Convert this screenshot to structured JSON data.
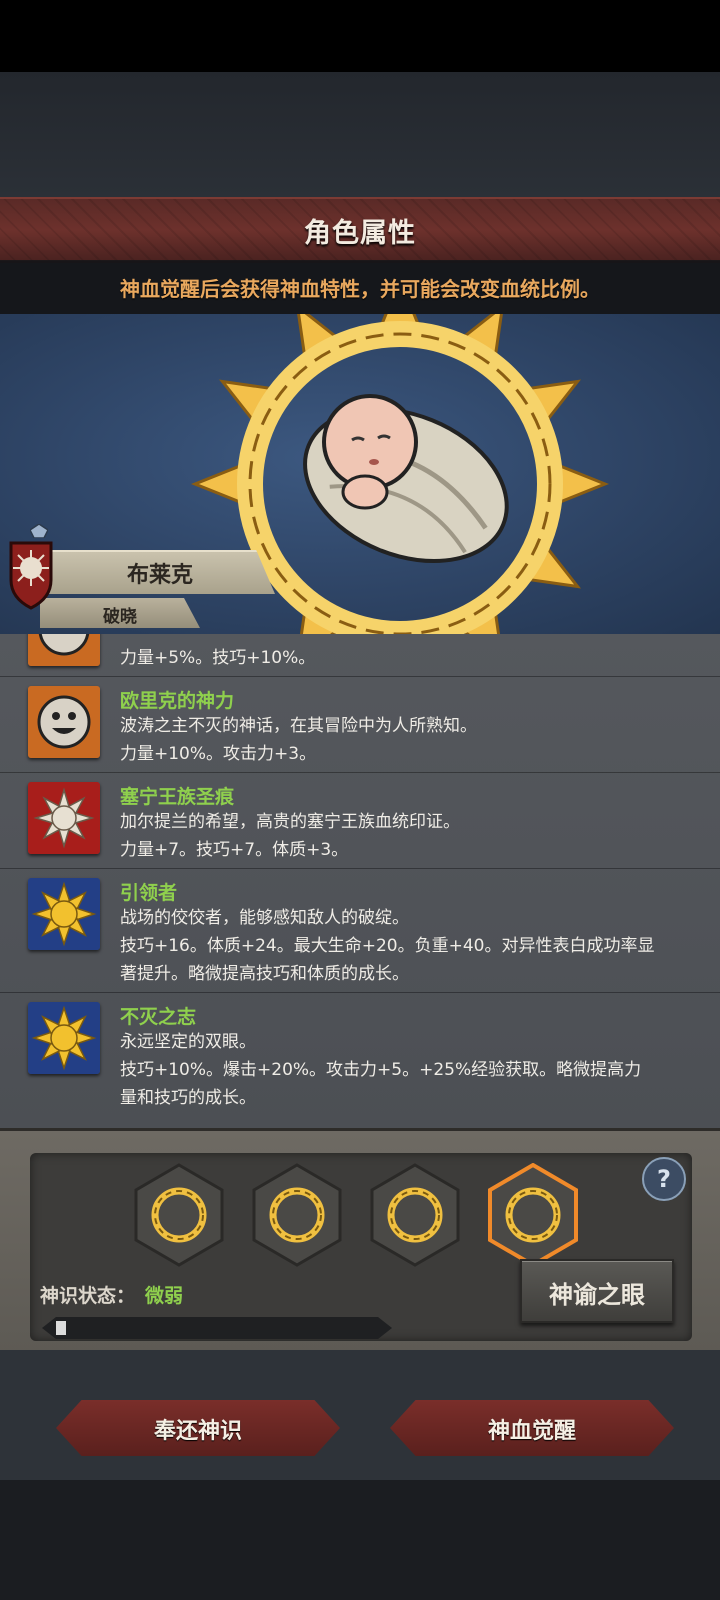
{
  "header": {
    "title": "角色属性",
    "notice": "神血觉醒后会获得神血特性，并可能会改变血统比例。"
  },
  "character": {
    "name": "布莱克",
    "subtitle": "破晓"
  },
  "traits": [
    {
      "name": "",
      "icon": "face-icon",
      "lines": [
        "力量+5%。技巧+10%。"
      ]
    },
    {
      "name": "欧里克的神力",
      "icon": "smile-face-icon",
      "lines": [
        "波涛之主不灭的神话，在其冒险中为人所熟知。",
        "力量+10%。攻击力+3。"
      ]
    },
    {
      "name": "塞宁王族圣痕",
      "icon": "royal-sigil-icon",
      "lines": [
        "加尔提兰的希望，高贵的塞宁王族血统印证。",
        "力量+7。技巧+7。体质+3。"
      ]
    },
    {
      "name": "引领者",
      "icon": "golden-sun-icon",
      "lines": [
        "战场的佼佼者，能够感知敌人的破绽。",
        "技巧+16。体质+24。最大生命+20。负重+40。对异性表白成功率显",
        "著提升。略微提高技巧和体质的成长。"
      ]
    },
    {
      "name": "不灭之志",
      "icon": "golden-sun-icon",
      "lines": [
        "永远坚定的双眼。",
        "技巧+10%。爆击+20%。攻击力+5。+25%经验获取。略微提高力",
        "量和技巧的成长。"
      ]
    }
  ],
  "awakening": {
    "slots": [
      {
        "icon": "sun-emblem-icon",
        "selected": false
      },
      {
        "icon": "sun-emblem-icon",
        "selected": false
      },
      {
        "icon": "sun-emblem-icon",
        "selected": false
      },
      {
        "icon": "sun-emblem-icon",
        "selected": true
      }
    ],
    "help_icon": "?",
    "status_label": "神识状态：",
    "status_value": "微弱",
    "progress": 0.03,
    "eye_button": "神谕之眼"
  },
  "actions": {
    "return_button": "奉还神识",
    "awaken_button": "神血觉醒"
  },
  "colors": {
    "banner": "#6d312c",
    "notice": "#e9a85e",
    "trait_name": "#8fd04d",
    "highlight": "#f08a2a"
  }
}
